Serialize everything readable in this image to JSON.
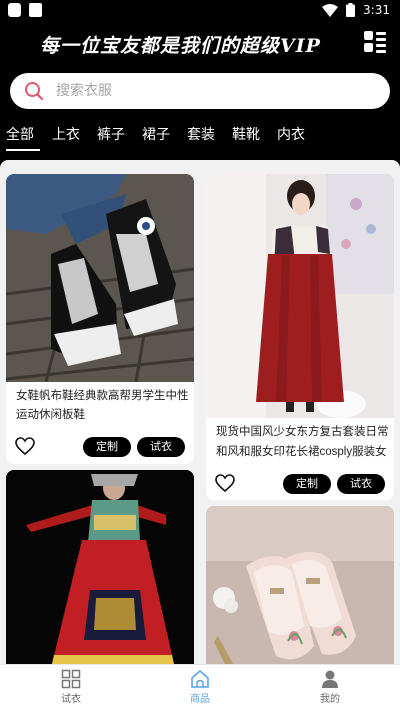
{
  "status": {
    "time": "3:31"
  },
  "banner": {
    "text": "每一位宝友都是我们的超级VIP"
  },
  "search": {
    "placeholder": "搜索衣服",
    "value": ""
  },
  "tabs": [
    {
      "label": "全部",
      "active": true
    },
    {
      "label": "上衣"
    },
    {
      "label": "裤子"
    },
    {
      "label": "裙子"
    },
    {
      "label": "套装"
    },
    {
      "label": "鞋靴"
    },
    {
      "label": "内衣"
    }
  ],
  "products": [
    {
      "title_line1": "女鞋帆布鞋经典款高帮男学生中性",
      "title_line2": "运动休闲板鞋",
      "btn_custom": "定制",
      "btn_try": "试衣"
    },
    {
      "title_line1": "现货中国风少女东方复古套装日常",
      "title_line2": "和风和服女印花长裙cosply服装女",
      "btn_custom": "定制",
      "btn_try": "试衣"
    },
    {
      "title_line1": "",
      "title_line2": ""
    },
    {
      "title_line1": "",
      "title_line2": ""
    }
  ],
  "bottom_nav": [
    {
      "label": "试衣",
      "icon": "grid-icon"
    },
    {
      "label": "商品",
      "icon": "home-icon",
      "active": true
    },
    {
      "label": "我的",
      "icon": "person-icon"
    }
  ],
  "colors": {
    "accent": "#5aa5e6",
    "background": "#000000",
    "content_bg": "#f1f1f1",
    "search_icon": "#e4576b"
  }
}
